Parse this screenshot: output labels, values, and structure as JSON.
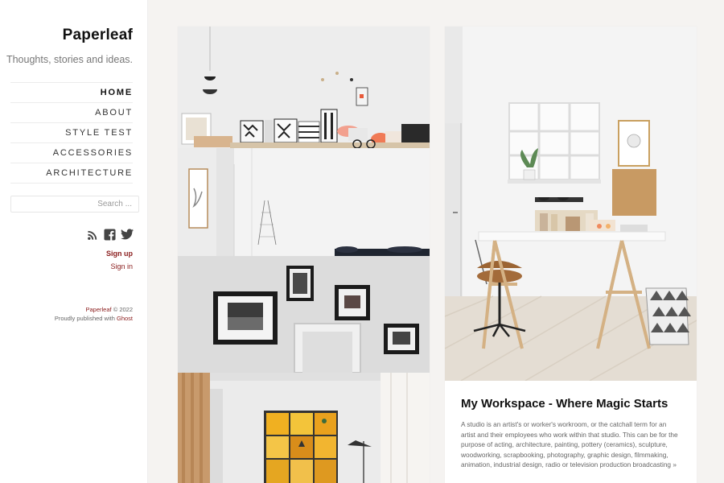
{
  "site": {
    "title": "Paperleaf",
    "description": "Thoughts, stories and ideas."
  },
  "nav": [
    {
      "label": "HOME",
      "active": true
    },
    {
      "label": "ABOUT"
    },
    {
      "label": "STYLE TEST"
    },
    {
      "label": "ACCESSORIES"
    },
    {
      "label": "ARCHITECTURE"
    }
  ],
  "search": {
    "placeholder": "Search ..."
  },
  "social": [
    "rss-icon",
    "facebook-icon",
    "twitter-icon"
  ],
  "auth": {
    "signup": "Sign up",
    "signin": "Sign in"
  },
  "footer": {
    "site_link": "Paperleaf",
    "copyright": "© 2022",
    "published_text": "Proudly published with",
    "ghost_link": "Ghost"
  },
  "colors": {
    "accent": "#8a1c1c",
    "background": "#f5f3f1",
    "sidebar": "#ffffff"
  },
  "featured_post": {
    "title": "My Workspace - Where Magic Starts",
    "excerpt": "A studio is an artist's or worker's workroom, or the catchall term for an artist and their employees who work within that studio. This can be for the purpose of acting, architecture, painting, pottery (ceramics), sculpture, woodworking, scrapbooking, photography, graphic design, filmmaking, animation, industrial design, radio or television production broadcasting »"
  }
}
